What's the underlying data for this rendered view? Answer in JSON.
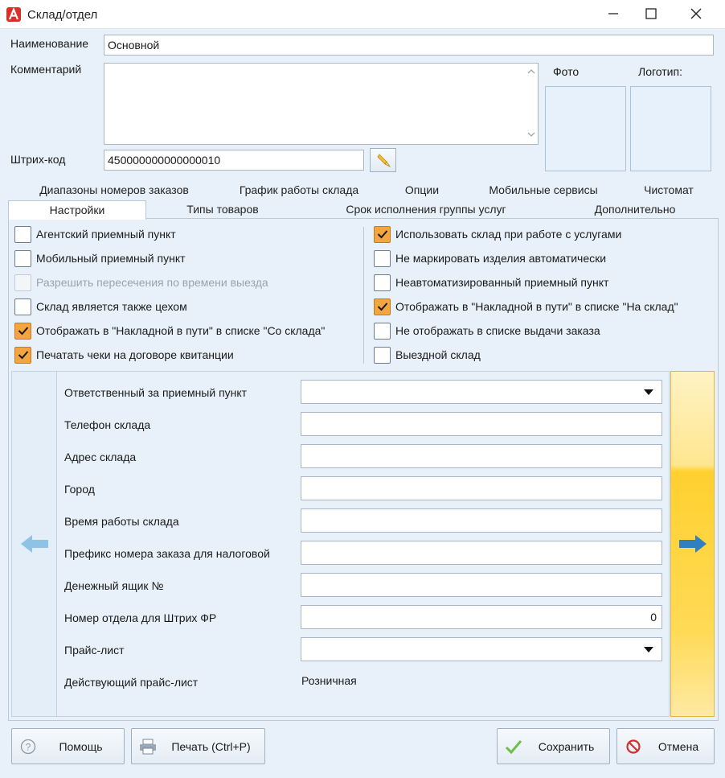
{
  "window": {
    "title": "Склад/отдел",
    "minimize_glyph": "—",
    "maximize_glyph": "☐",
    "close_glyph": "✕"
  },
  "fields": {
    "name_label": "Наименование",
    "name_value": "Основной",
    "comment_label": "Комментарий",
    "comment_value": "",
    "barcode_label": "Штрих-код",
    "barcode_value": "450000000000000010",
    "photo_label": "Фото",
    "logo_label": "Логотип:"
  },
  "tabs": {
    "row1": [
      "Диапазоны номеров заказов",
      "График работы склада",
      "Опции",
      "Мобильные сервисы",
      "Чистомат"
    ],
    "row2": [
      "Настройки",
      "Типы товаров",
      "Срок исполнения группы услуг",
      "Дополнительно"
    ],
    "active": "Настройки"
  },
  "checkboxes_left": [
    {
      "label": "Агентский приемный пункт",
      "checked": false,
      "disabled": false
    },
    {
      "label": "Мобильный приемный пункт",
      "checked": false,
      "disabled": false
    },
    {
      "label": "Разрешить пересечения по времени выезда",
      "checked": false,
      "disabled": true
    },
    {
      "label": "Склад является также цехом",
      "checked": false,
      "disabled": false
    },
    {
      "label": "Отображать в \"Накладной в пути\" в списке \"Со склада\"",
      "checked": true,
      "disabled": false
    },
    {
      "label": "Печатать чеки на договоре квитанции",
      "checked": true,
      "disabled": false
    }
  ],
  "checkboxes_right": [
    {
      "label": "Использовать склад при работе с услугами",
      "checked": true,
      "disabled": false
    },
    {
      "label": "Не маркировать изделия автоматически",
      "checked": false,
      "disabled": false
    },
    {
      "label": "Неавтоматизированный приемный пункт",
      "checked": false,
      "disabled": false
    },
    {
      "label": "Отображать в \"Накладной в пути\" в списке \"На склад\"",
      "checked": true,
      "disabled": false
    },
    {
      "label": "Не отображать в списке выдачи заказа",
      "checked": false,
      "disabled": false
    },
    {
      "label": "Выездной склад",
      "checked": false,
      "disabled": false
    }
  ],
  "form": {
    "responsible_label": "Ответственный за приемный пункт",
    "responsible_value": "",
    "phone_label": "Телефон склада",
    "phone_value": "",
    "address_label": "Адрес склада",
    "address_value": "",
    "city_label": "Город",
    "city_value": "",
    "hours_label": "Время работы склада",
    "hours_value": "",
    "prefix_label": "Префикс номера заказа для налоговой",
    "prefix_value": "",
    "cashbox_label": "Денежный ящик №",
    "cashbox_value": "",
    "dept_label": "Номер отдела для Штрих ФР",
    "dept_value": "0",
    "pricelist_label": "Прайс-лист",
    "pricelist_value": "",
    "active_pricelist_label": "Действующий прайс-лист",
    "active_pricelist_value": "Розничная"
  },
  "buttons": {
    "help": "Помощь",
    "print": "Печать (Ctrl+P)",
    "save": "Сохранить",
    "cancel": "Отмена"
  },
  "colors": {
    "background": "#e8f1fa",
    "check_accent": "#f2a541",
    "nav_right": "#ffd030",
    "arrow_blue": "#2f7fc1",
    "arrow_disabled": "#8fc3e6"
  }
}
